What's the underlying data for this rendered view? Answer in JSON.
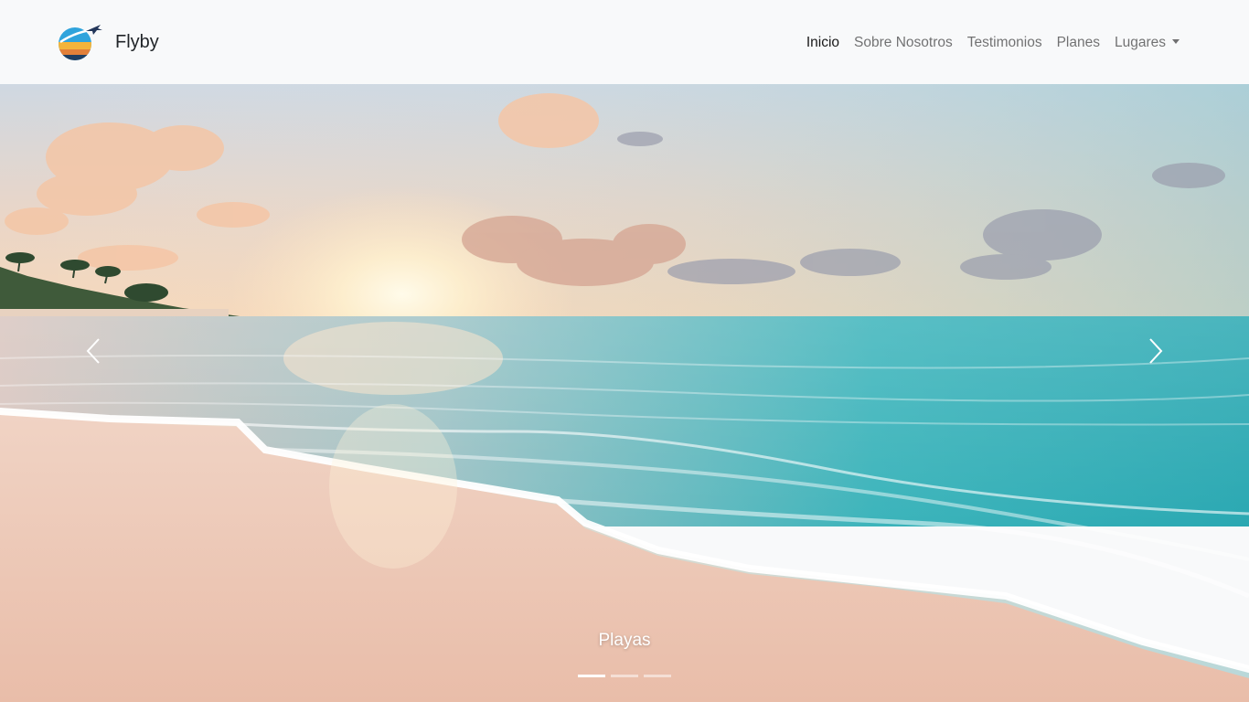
{
  "navbar": {
    "brand": "Flyby",
    "logo_icon": "airplane-globe-logo-icon",
    "links": [
      {
        "label": "Inicio",
        "active": true
      },
      {
        "label": "Sobre Nosotros",
        "active": false
      },
      {
        "label": "Testimonios",
        "active": false
      },
      {
        "label": "Planes",
        "active": false
      },
      {
        "label": "Lugares",
        "active": false,
        "dropdown": true
      }
    ]
  },
  "carousel": {
    "caption": "Playas",
    "prev_icon": "chevron-left-icon",
    "next_icon": "chevron-right-icon",
    "slide_count": 3,
    "active_index": 0
  },
  "colors": {
    "navbar_bg": "#f8f9fa",
    "brand_text": "#212529",
    "sky_top": "#d6dde6",
    "sea": "#3cb7bd",
    "sand": "#eec8b6"
  }
}
